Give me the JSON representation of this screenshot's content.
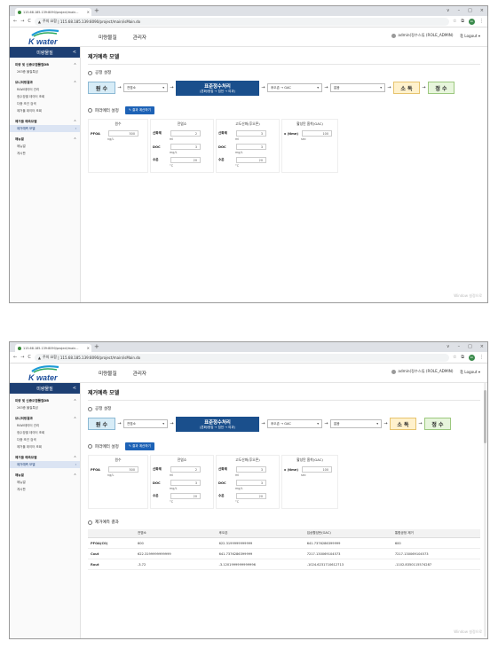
{
  "browser": {
    "tab_title": "115.68.185.139:8090/project/main...",
    "new_tab": "+",
    "tab_close": "×",
    "win_controls": [
      "∨",
      "–",
      "□",
      "×"
    ],
    "nav": [
      "←",
      "→",
      "C"
    ],
    "url_warning": "주의 요함",
    "url": "115.68.185.139:8090/project/main/isMain.do",
    "avatar": "ko"
  },
  "header": {
    "logo": "K water",
    "menu": [
      "미량물질",
      "관리자"
    ],
    "user": "admin(정수스튜 (ROLE_ADMIN)",
    "logout": "Logout"
  },
  "sidebar": {
    "title": "미량물질",
    "collapse": "<",
    "groups": [
      {
        "label": "미량 및 신종오염물질DB",
        "items": [
          "263종 물질특성"
        ]
      },
      {
        "label": "모니터링결과",
        "items": [
          "RAW데이터 관리",
          "정수장별 데이터 조회",
          "다중 조건 검색",
          "제거율 데이터 조회"
        ]
      },
      {
        "label": "제거율 예측모델",
        "items": [
          "제거예측 모델"
        ]
      },
      {
        "label": "매뉴얼",
        "items": [
          "매뉴얼",
          "게시판"
        ]
      }
    ]
  },
  "page": {
    "title": "제거예측 모델",
    "section_process": "공정 설정",
    "section_params": "파라메터 설정",
    "calc_button": "결과 계산하기",
    "section_results": "제거예측 결과"
  },
  "flow": {
    "source": "원 수",
    "pre": "전염소",
    "standard_title": "표준정수처리",
    "standard_sub": "(혼화/응집 → 침전 → 여과)",
    "post": "후오존 → GAC",
    "extra": "없음",
    "disinfection": "소 독",
    "clean": "정 수",
    "arrow": "→"
  },
  "params": {
    "raw": {
      "head": "원수",
      "label": "PFOA",
      "value": "500",
      "unit": "ng/L"
    },
    "chlorine": {
      "head": "전염소",
      "rows": [
        {
          "label": "산화제",
          "value": "2",
          "unit": "ml"
        },
        {
          "label": "DOC",
          "value": "3",
          "unit": "mg/L"
        },
        {
          "label": "수온",
          "value": "20",
          "unit": "°C"
        }
      ]
    },
    "ozone": {
      "head": "고도산화(후오존)",
      "rows": [
        {
          "label": "산화제",
          "value": "3",
          "unit": "ml"
        },
        {
          "label": "DOC",
          "value": "3",
          "unit": "mg/L"
        },
        {
          "label": "수온",
          "value": "20",
          "unit": "°C"
        }
      ]
    },
    "gac": {
      "head": "활성탄 흡착(GAC)",
      "label": "x (time)",
      "value": "100",
      "unit": "sec"
    }
  },
  "results": {
    "columns": [
      "",
      "전염소",
      "후오존",
      "입상활성탄(GAC)",
      "통합공정 제거"
    ],
    "rows": [
      [
        "PFOA(C0)",
        "600",
        "622.3199999999999",
        "641.7376286399999",
        "600"
      ],
      [
        "Cout",
        "622.3199999999999",
        "641.7376286399999",
        "7217.130069104573",
        "7217.130069104573"
      ],
      [
        "Rout",
        "-3.72",
        "-3.1201999999999996",
        "-1024.6231710612713",
        "-1102.8350115574287"
      ]
    ]
  },
  "watermark": "Window\n설정으로"
}
